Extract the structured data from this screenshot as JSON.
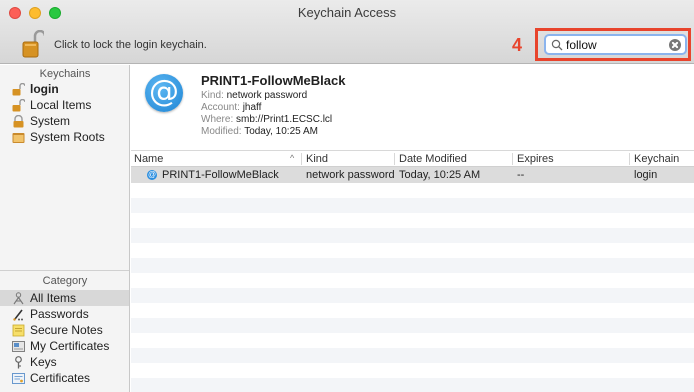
{
  "window": {
    "title": "Keychain Access"
  },
  "toolbar": {
    "lock_text": "Click to lock the login keychain.",
    "step_number": "4",
    "search": {
      "value": "follow",
      "placeholder": ""
    }
  },
  "sidebar": {
    "keychains_header": "Keychains",
    "keychains": [
      {
        "label": "login",
        "icon": "open-lock-icon"
      },
      {
        "label": "Local Items",
        "icon": "open-lock-icon"
      },
      {
        "label": "System",
        "icon": "locked-icon"
      },
      {
        "label": "System Roots",
        "icon": "folder-icon"
      }
    ],
    "category_header": "Category",
    "categories": [
      {
        "label": "All Items",
        "icon": "all-items-icon"
      },
      {
        "label": "Passwords",
        "icon": "passwords-icon"
      },
      {
        "label": "Secure Notes",
        "icon": "secure-notes-icon"
      },
      {
        "label": "My Certificates",
        "icon": "my-certificates-icon"
      },
      {
        "label": "Keys",
        "icon": "key-icon"
      },
      {
        "label": "Certificates",
        "icon": "certificate-icon"
      }
    ]
  },
  "detail": {
    "title": "PRINT1-FollowMeBlack",
    "kind_key": "Kind:",
    "kind_value": "network password",
    "account_key": "Account:",
    "account_value": "jhaff",
    "where_key": "Where:",
    "where_value": "smb://Print1.ECSC.lcl",
    "modified_key": "Modified:",
    "modified_value": "Today, 10:25 AM"
  },
  "table": {
    "columns": [
      "Name",
      "Kind",
      "Date Modified",
      "Expires",
      "Keychain"
    ],
    "sort_indicator": "^",
    "rows": [
      {
        "name": "PRINT1-FollowMeBlack",
        "kind": "network password",
        "date_modified": "Today, 10:25 AM",
        "expires": "--",
        "keychain": "login"
      }
    ]
  },
  "colors": {
    "highlight": "#e8442c",
    "accent": "#1d84d4"
  }
}
